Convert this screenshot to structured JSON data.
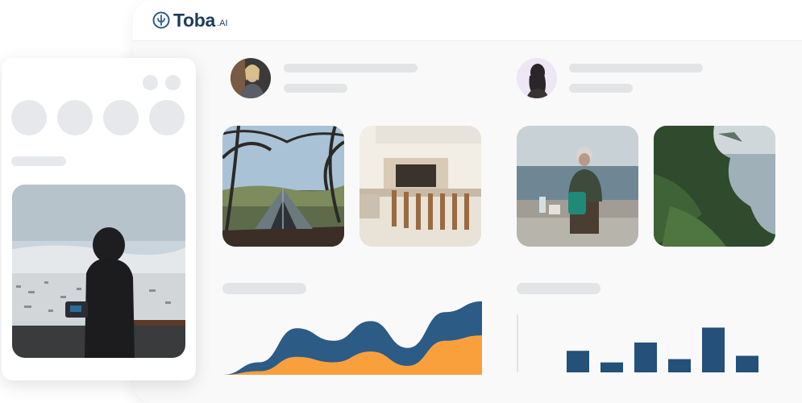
{
  "brand": {
    "name": "Toba",
    "suffix": ".AI"
  },
  "colors": {
    "navy": "#2c5b86",
    "orange": "#f9a03c",
    "bar": "#24507a",
    "skeleton": "#e3e4e6"
  },
  "feed": {
    "posts": [
      {
        "avatar": "woman-portrait",
        "photos": [
          "camping-tent-under-trees",
          "outdoor-kitchen-bar-stools"
        ]
      },
      {
        "avatar": "woman-silhouette",
        "photos": [
          "old-man-sitting-by-sea",
          "green-coastal-cliffs"
        ]
      }
    ]
  },
  "side_panel": {
    "photo": "person-overlooking-snowy-city"
  },
  "chart_data": [
    {
      "type": "area",
      "title": "",
      "xlabel": "",
      "ylabel": "",
      "x": [
        0,
        1,
        2,
        3,
        4,
        5,
        6,
        7
      ],
      "series": [
        {
          "values": [
            0,
            14,
            52,
            38,
            60,
            30,
            70,
            82
          ]
        },
        {
          "values": [
            0,
            4,
            20,
            14,
            26,
            10,
            38,
            44
          ]
        }
      ],
      "ylim": [
        0,
        90
      ]
    },
    {
      "type": "bar",
      "title": "",
      "xlabel": "",
      "ylabel": "",
      "categories": [
        "",
        "",
        "",
        "",
        "",
        ""
      ],
      "values": [
        26,
        12,
        36,
        16,
        54,
        20
      ],
      "ylim": [
        0,
        70
      ]
    }
  ]
}
